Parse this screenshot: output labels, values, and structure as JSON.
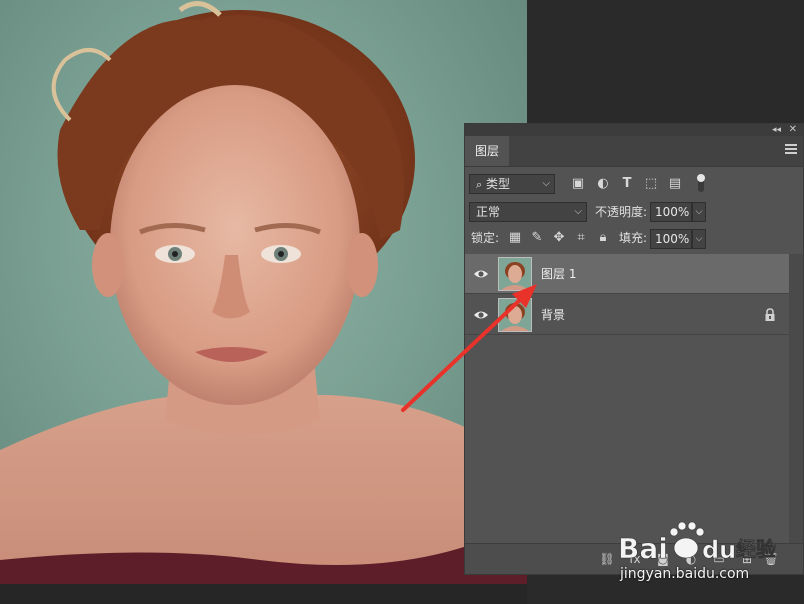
{
  "panel": {
    "tab_label": "图层",
    "filter_dropdown": "类型",
    "blend_mode": "正常",
    "opacity_label": "不透明度:",
    "opacity_value": "100%",
    "lock_label": "锁定:",
    "fill_label": "填充:",
    "fill_value": "100%"
  },
  "layers": [
    {
      "name": "图层 1",
      "selected": true,
      "locked": false
    },
    {
      "name": "背景",
      "selected": false,
      "locked": true
    }
  ],
  "watermark": {
    "logo_text": "Bai du 经验",
    "url": "jingyan.baidu.com"
  },
  "colors": {
    "panel_bg": "#535353",
    "selected_row": "#6a6a6a",
    "arrow": "#e8322a"
  }
}
